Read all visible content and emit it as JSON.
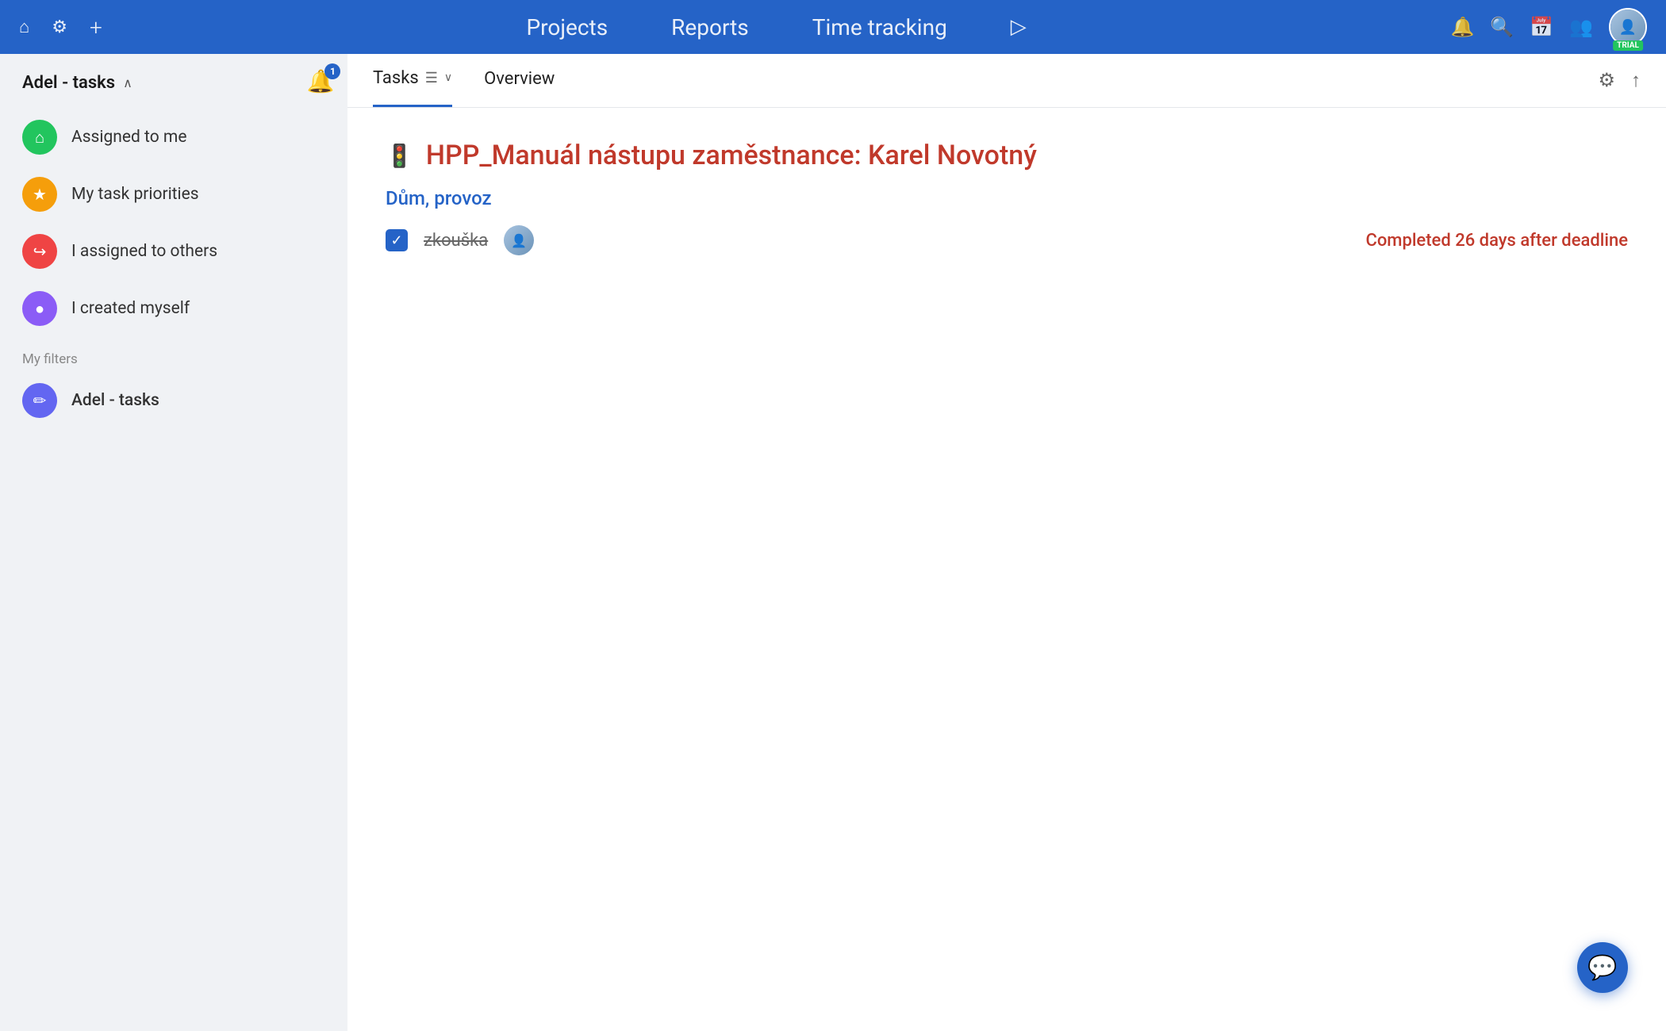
{
  "topnav": {
    "home_icon": "⌂",
    "settings_icon": "⚙",
    "add_icon": "+",
    "nav_links": [
      {
        "id": "projects",
        "label": "Projects"
      },
      {
        "id": "reports",
        "label": "Reports"
      },
      {
        "id": "time_tracking",
        "label": "Time tracking"
      }
    ],
    "play_icon": "▷",
    "bell_icon": "🔔",
    "search_icon": "🔍",
    "calendar_icon": "📅",
    "team_icon": "👥",
    "trial_label": "TRIAL"
  },
  "sidebar": {
    "header_title": "Adel - tasks",
    "items": [
      {
        "id": "assigned-to-me",
        "label": "Assigned to me",
        "icon": "⌂",
        "color": "#22c55e"
      },
      {
        "id": "my-task-priorities",
        "label": "My task priorities",
        "icon": "★",
        "color": "#f59e0b"
      },
      {
        "id": "i-assigned-to-others",
        "label": "I assigned to others",
        "icon": "↪",
        "color": "#ef4444"
      },
      {
        "id": "i-created-myself",
        "label": "I created myself",
        "icon": "●",
        "color": "#8b5cf6"
      }
    ],
    "filters_section_label": "My filters",
    "filter_items": [
      {
        "id": "adel-tasks",
        "label": "Adel - tasks",
        "icon": "✏",
        "color": "#6366f1"
      }
    ]
  },
  "notification_badge": {
    "count": "1",
    "icon": "🔔"
  },
  "tabs": [
    {
      "id": "tasks",
      "label": "Tasks",
      "active": true,
      "has_filter_icon": true
    },
    {
      "id": "overview",
      "label": "Overview",
      "active": false
    }
  ],
  "task_section": {
    "status_icon": "🚦",
    "title": "HPP_Manuál nástupu zaměstnance: Karel Novotný",
    "project_label": "Dům, provoz",
    "task_name": "zkouška",
    "deadline_text": "Completed 26 days after deadline"
  },
  "chat_button": {
    "icon": "💬"
  }
}
